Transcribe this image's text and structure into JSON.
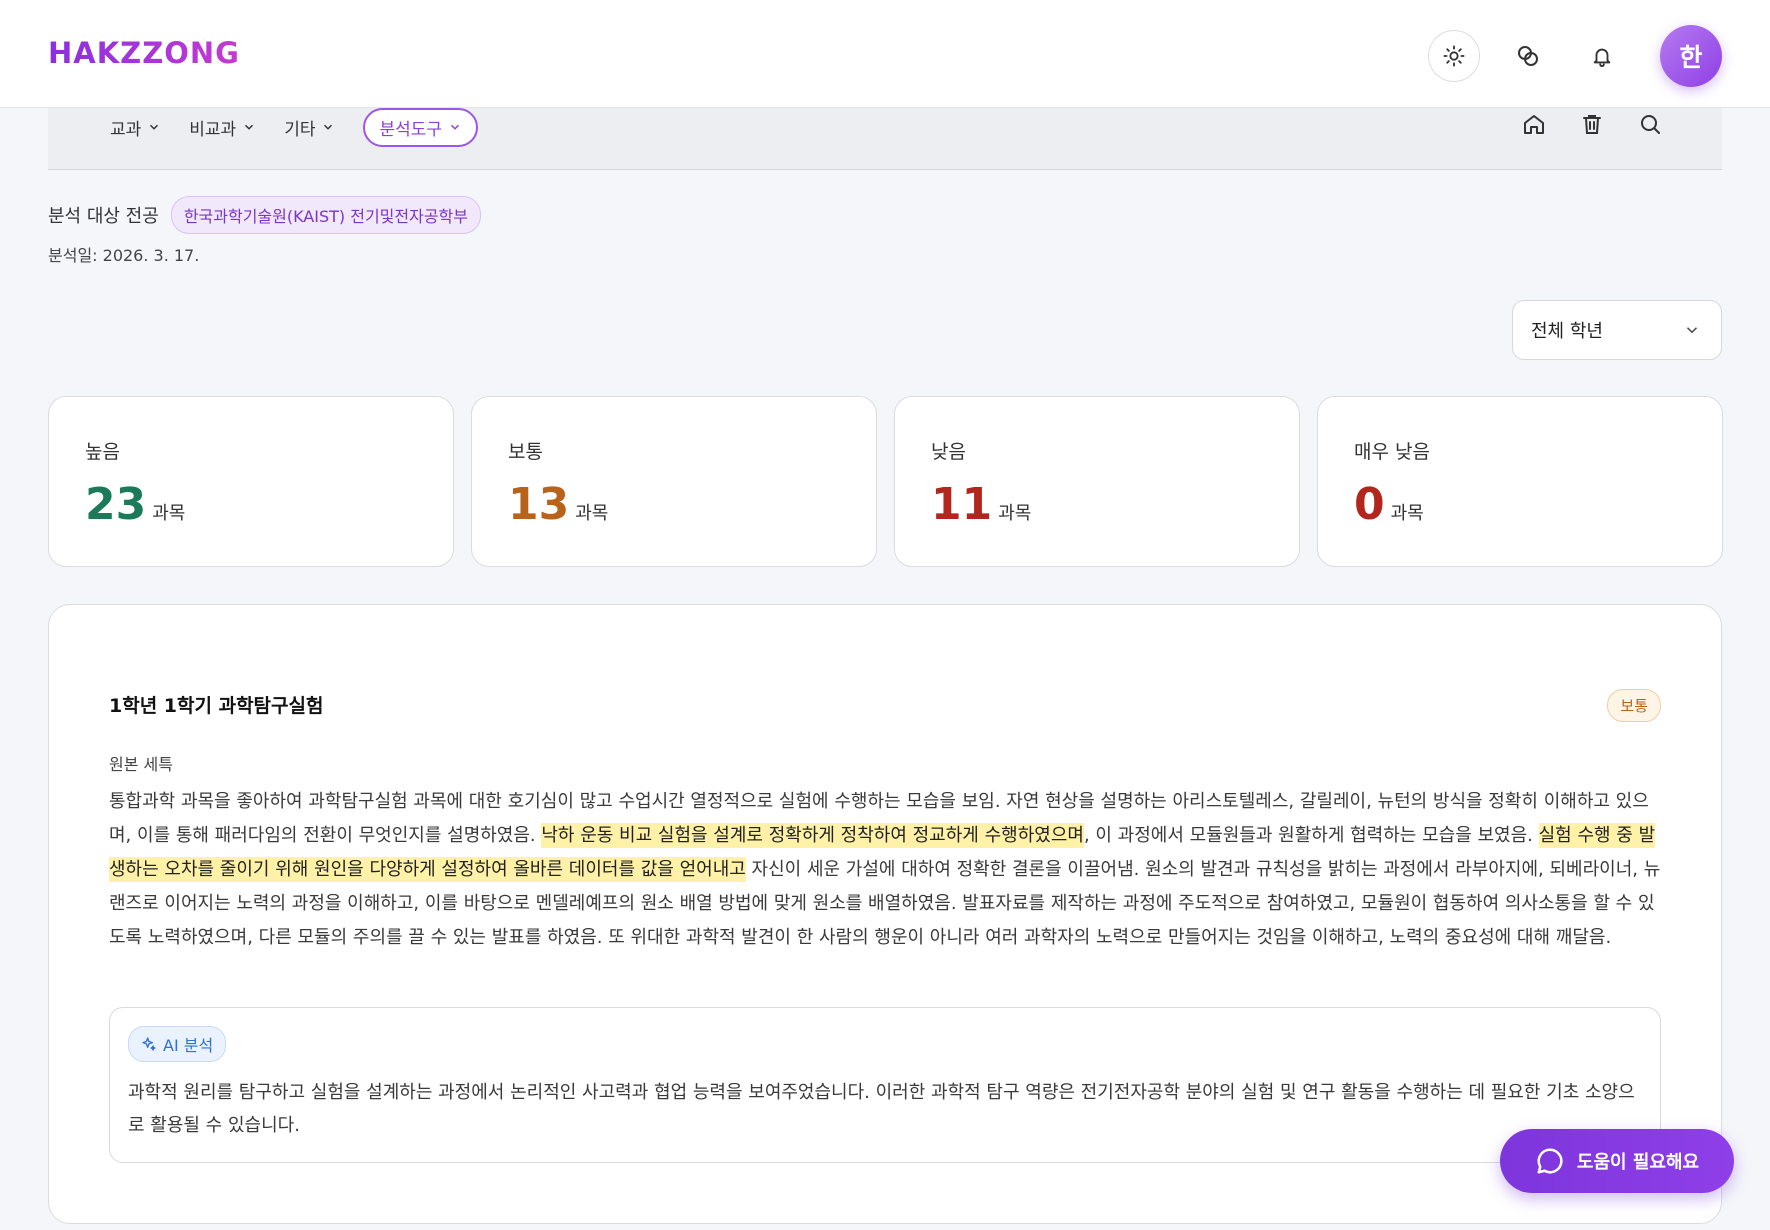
{
  "app": {
    "logo": "HAKZZONG",
    "avatar_initial": "한",
    "top_icons": [
      "theme-sun-icon",
      "link-icon",
      "bell-icon"
    ]
  },
  "nav": {
    "items": [
      {
        "label": "교과"
      },
      {
        "label": "비교과"
      },
      {
        "label": "기타"
      },
      {
        "label": "분석도구",
        "active": true
      }
    ],
    "right_icons": [
      "home-icon",
      "trash-icon",
      "search-icon"
    ]
  },
  "analysis": {
    "major_label": "분석 대상 전공",
    "major_value": "한국과학기술원(KAIST) 전기및전자공학부",
    "date_text": "분석일: 2026. 3. 17.",
    "grade_filter": "전체 학년"
  },
  "stats": [
    {
      "label": "높음",
      "count": "23",
      "unit": "과목",
      "color": "#1a7a5a"
    },
    {
      "label": "보통",
      "count": "13",
      "unit": "과목",
      "color": "#b8621a"
    },
    {
      "label": "낮음",
      "count": "11",
      "unit": "과목",
      "color": "#b3261e"
    },
    {
      "label": "매우 낮음",
      "count": "0",
      "unit": "과목",
      "color": "#b3261e"
    }
  ],
  "detail": {
    "subject_title": "1학년 1학기 과학탐구실험",
    "level_badge": "보통",
    "original_label": "원본 세특",
    "original_text": {
      "p1": "통합과학 과목을 좋아하여 과학탐구실험 과목에 대한 호기심이 많고 수업시간 열정적으로 실험에 수행하는 모습을 보임. 자연 현상을 설명하는 아리스토텔레스, 갈릴레이, 뉴턴의 방식을 정확히 이해하고 있으며, 이를 통해 패러다임의 전환이 무엇인지를 설명하였음. ",
      "h1": "낙하 운동 비교 실험을 설계로 정확하게 정착하여 정교하게 수행하였으며",
      "p2": ", 이 과정에서 모듈원들과 원활하게 협력하는 모습을 보였음. ",
      "h2": "실험 수행 중 발생하는 오차를 줄이기 위해 원인을 다양하게 설정하여 올바른 데이터를 값을 얻어내고",
      "p3": " 자신이 세운 가설에 대하여 정확한 결론을 이끌어냄. 원소의 발견과 규칙성을 밝히는 과정에서 라부아지에, 되베라이너, 뉴랜즈로 이어지는 노력의 과정을 이해하고, 이를 바탕으로 멘델레예프의 원소 배열 방법에 맞게 원소를 배열하였음. 발표자료를 제작하는 과정에 주도적으로 참여하였고, 모듈원이 협동하여 의사소통을 할 수 있도록 노력하였으며, 다른 모듈의 주의를 끌 수 있는 발표를 하였음. 또 위대한 과학적 발견이 한 사람의 행운이 아니라 여러 과학자의 노력으로 만들어지는 것임을 이해하고, 노력의 중요성에 대해 깨달음."
    },
    "ai_label": "AI 분석",
    "ai_text": "과학적 원리를 탐구하고 실험을 설계하는 과정에서 논리적인 사고력과 협업 능력을 보여주었습니다. 이러한 과학적 탐구 역량은 전기전자공학 분야의 실험 및 연구 활동을 수행하는 데 필요한 기초 소양으로 활용될 수 있습니다."
  },
  "help_button": "도움이 필요해요",
  "colors": {
    "accent": "#8a3fe0",
    "highlight": "#fff2a8"
  }
}
